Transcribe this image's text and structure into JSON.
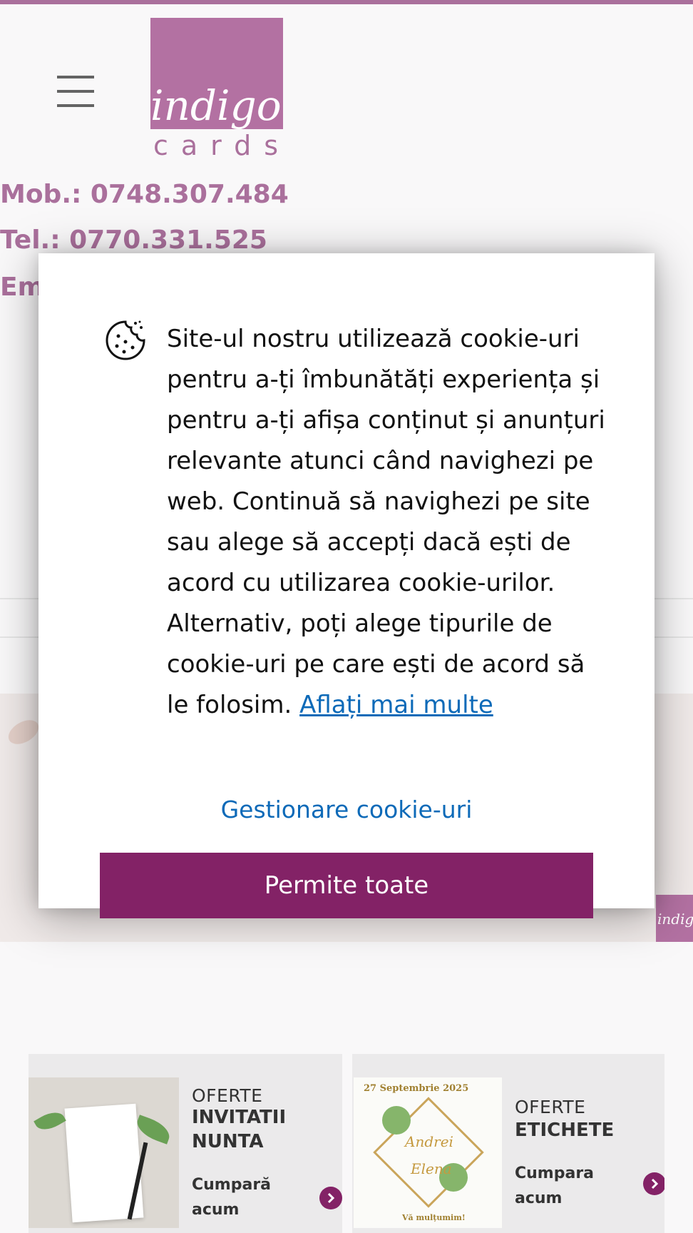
{
  "header": {
    "logo_word": "indigo",
    "logo_sub": "cards",
    "mobile": "Mob.: 0748.307.484",
    "phone": "Tel.: 0770.331.525",
    "email_partial": "Em"
  },
  "cookie_modal": {
    "message": "Site-ul nostru utilizează cookie-uri pentru a-ți îmbunătăți experiența și pentru a-ți afișa conținut și anunțuri relevante atunci când navighezi pe web. Continuă să navighezi pe site sau alege să accepți dacă ești de acord cu utilizarea cookie-urilor. Alternativ, poți alege tipurile de cookie-uri pe care ești de acord să le folosim.",
    "learn_more": "Aflați mai multe",
    "manage_label": "Gestionare cookie-uri",
    "accept_label": "Permite toate"
  },
  "offers": [
    {
      "kicker": "OFERTE",
      "title": "INVITATII NUNTA",
      "cta": "Cumpară acum"
    },
    {
      "kicker": "OFERTE",
      "title": "ETICHETE",
      "cta": "Cumpara acum",
      "image_text": {
        "date": "27 Septembrie 2025",
        "name1": "Andrei",
        "name2": "Elena",
        "thanks": "Vă mulțumim!"
      }
    }
  ],
  "banner": {
    "mini_logo": "indig"
  },
  "colors": {
    "brand": "#832266",
    "link": "#0d6ab8"
  },
  "icons": {
    "menu": "hamburger-menu-icon",
    "cookie": "cookie-icon",
    "arrow": "chevron-right-icon"
  }
}
